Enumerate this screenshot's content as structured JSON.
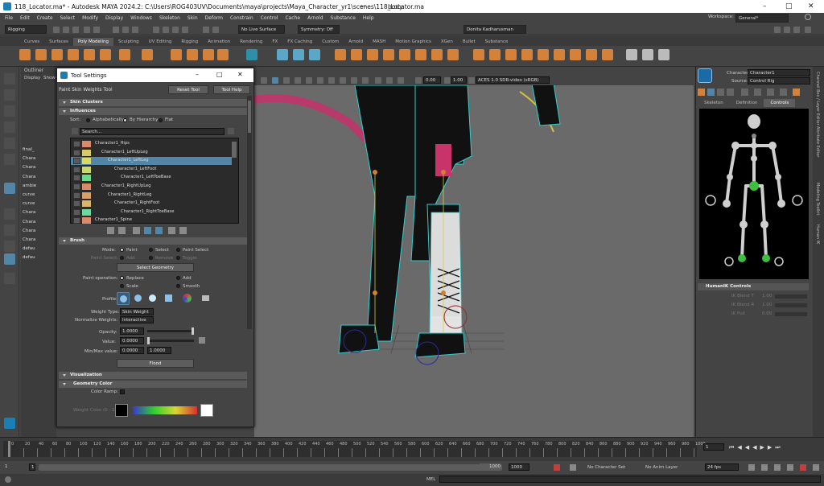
{
  "window": {
    "title": "118_Locator.ma* - Autodesk MAYA 2024.2: C:\\Users\\ROG403UV\\Documents\\maya\\projects\\Maya_Character_yr1\\scenes\\118_Locator.ma",
    "dots": "---",
    "mode": "body",
    "logo": "M"
  },
  "menu": [
    "File",
    "Edit",
    "Create",
    "Select",
    "Modify",
    "Display",
    "Windows",
    "Skeleton",
    "Skin",
    "Deform",
    "Constrain",
    "Control",
    "Cache",
    "Arnold",
    "Substance",
    "Help"
  ],
  "workspace_label": "Workspace:",
  "workspace_value": "General*",
  "statusline": {
    "menuset": "Rigging",
    "live_surface": "No Live Surface",
    "symmetry": "Symmetry: Off",
    "user": "Donita Kadharusman"
  },
  "shelf_tabs": [
    "Curves",
    "Surfaces",
    "Poly Modeling",
    "Sculpting",
    "UV Editing",
    "Rigging",
    "Animation",
    "Rendering",
    "FX",
    "FX Caching",
    "Custom",
    "Arnold",
    "MASH",
    "Motion Graphics",
    "XGen",
    "Bullet",
    "Substance"
  ],
  "shelf_active": "Poly Modeling",
  "outliner": {
    "title": "Outliner",
    "menu1": "Display",
    "menu2": "Show",
    "rows": [
      "final_",
      "Chara",
      "Chara",
      "Chara",
      "ambie",
      "curve",
      "curve",
      "Chara",
      "Chara",
      "Chara",
      "Chara",
      "defau",
      "defau"
    ]
  },
  "tool_settings": {
    "title": "Tool Settings",
    "tool_name": "Paint Skin Weights Tool",
    "reset": "Reset Tool",
    "help": "Tool Help",
    "sections": {
      "skin_clusters": "Skin Clusters",
      "influences": "Influences",
      "brush": "Brush",
      "visualization": "Visualization",
      "geometry_color": "Geometry Color"
    },
    "sort_label": "Sort:",
    "sort_opts": [
      "Alphabetically",
      "By Hierarchy",
      "Flat"
    ],
    "search_placeholder": "Search...",
    "influences": [
      {
        "name": "Character1_Hips",
        "color": "#d98a6a"
      },
      {
        "name": "Character1_LeftUpLeg",
        "color": "#d9c86a"
      },
      {
        "name": "Character1_LeftLeg",
        "color": "#d9d96a"
      },
      {
        "name": "Character1_LeftFoot",
        "color": "#c8d96a"
      },
      {
        "name": "Character1_LeftToeBase",
        "color": "#6ad98a"
      },
      {
        "name": "Character1_RightUpLeg",
        "color": "#d98a6a"
      },
      {
        "name": "Character1_RightLeg",
        "color": "#d9a06a"
      },
      {
        "name": "Character1_RightFoot",
        "color": "#d9b46a"
      },
      {
        "name": "Character1_RightToeBase",
        "color": "#6ad9a0"
      },
      {
        "name": "Character1_Spine",
        "color": "#d98a6a"
      }
    ],
    "mode_label": "Mode:",
    "mode_opts": [
      "Paint",
      "Select",
      "Paint Select"
    ],
    "paint_select_label": "Paint Select:",
    "paint_select_opts": [
      "Add",
      "Remove",
      "Toggle"
    ],
    "select_geometry": "Select Geometry",
    "paint_op_label": "Paint operation:",
    "paint_ops": [
      "Replace",
      "Add",
      "Scale",
      "Smooth"
    ],
    "profile_label": "Profile:",
    "weight_type_label": "Weight Type:",
    "weight_type": "Skin Weight",
    "normalize_label": "Normalize Weights:",
    "normalize": "Interactive",
    "opacity_label": "Opacity:",
    "opacity": "1.0000",
    "value_label": "Value:",
    "value": "0.0000",
    "minmax_label": "Min/Max value:",
    "min": "0.0000",
    "max": "1.0000",
    "flood": "Flood",
    "color_ramp_label": "Color Ramp:",
    "weight_color_label": "Weight Color (0 - 1):"
  },
  "viewport": {
    "val1": "0.00",
    "val2": "1.00",
    "colorspace": "ACES 1.0 SDR-video (sRGB)"
  },
  "hik": {
    "character_label": "Character:",
    "character": "Character1",
    "source_label": "Source:",
    "source": "Control Rig",
    "tabs": [
      "Skeleton",
      "Definition",
      "Controls"
    ],
    "active_tab": "Controls",
    "controls_header": "HumanIK Controls",
    "sliders": [
      {
        "label": "IK Blend T",
        "value": "1.00"
      },
      {
        "label": "IK Blend R",
        "value": "1.00"
      },
      {
        "label": "IK Pull",
        "value": "0.00"
      }
    ],
    "side_tabs": [
      "Channel Box / Layer Editor",
      "Attribute Editor",
      "Modeling Toolkit",
      "Human IK"
    ]
  },
  "timeline": {
    "ticks": [
      "0",
      "20",
      "40",
      "60",
      "80",
      "100",
      "120",
      "140",
      "160",
      "180",
      "200",
      "220",
      "240",
      "260",
      "280",
      "300",
      "320",
      "340",
      "360",
      "380",
      "400",
      "420",
      "440",
      "460",
      "480",
      "500",
      "520",
      "540",
      "560",
      "580",
      "600",
      "620",
      "640",
      "660",
      "680",
      "700",
      "720",
      "740",
      "760",
      "780",
      "800",
      "820",
      "840",
      "860",
      "880",
      "900",
      "920",
      "940",
      "960",
      "980",
      "1000"
    ],
    "current": "1"
  },
  "range": {
    "start": "1",
    "start2": "1",
    "end": "1000",
    "end2": "1000",
    "char_set": "No Character Set",
    "anim_layer": "No Anim Layer",
    "fps": "24 fps"
  },
  "cmd": {
    "label": "MEL"
  },
  "colors": {
    "accent": "#5285a6",
    "bg": "#444444",
    "viewport": "#6a6a6a",
    "hik_bg": "#000000",
    "selected_joint": "#3fbf3f"
  }
}
